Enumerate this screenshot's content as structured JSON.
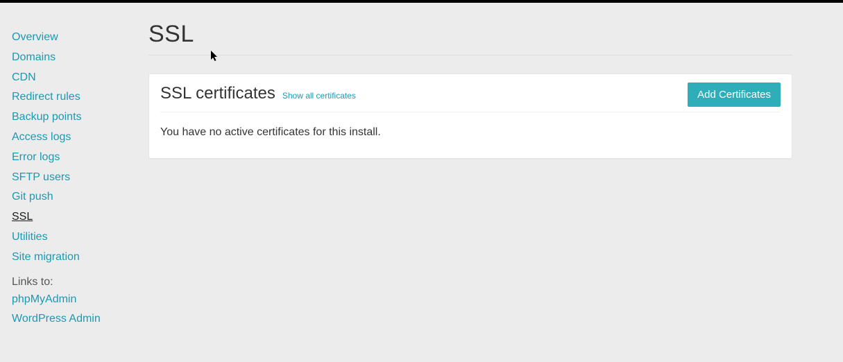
{
  "sidebar": {
    "items": [
      {
        "label": "Overview",
        "active": false
      },
      {
        "label": "Domains",
        "active": false
      },
      {
        "label": "CDN",
        "active": false
      },
      {
        "label": "Redirect rules",
        "active": false
      },
      {
        "label": "Backup points",
        "active": false
      },
      {
        "label": "Access logs",
        "active": false
      },
      {
        "label": "Error logs",
        "active": false
      },
      {
        "label": "SFTP users",
        "active": false
      },
      {
        "label": "Git push",
        "active": false
      },
      {
        "label": "SSL",
        "active": true
      },
      {
        "label": "Utilities",
        "active": false
      },
      {
        "label": "Site migration",
        "active": false
      }
    ],
    "links_header": "Links to:",
    "links": [
      {
        "label": "phpMyAdmin"
      },
      {
        "label": "WordPress Admin"
      }
    ]
  },
  "page": {
    "title": "SSL",
    "panel": {
      "title": "SSL certificates",
      "sublink": "Show all certificates",
      "button": "Add Certificates",
      "empty_message": "You have no active certificates for this install."
    }
  }
}
